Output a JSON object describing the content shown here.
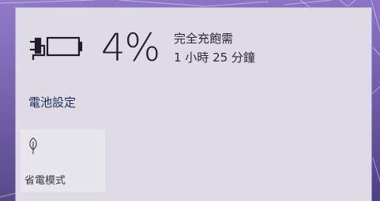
{
  "battery": {
    "percent": "4%",
    "status": "完全充飽需",
    "time_remaining": "1 小時 25 分鐘"
  },
  "settings_link": "電池設定",
  "quick_action": {
    "label": "省電模式",
    "icon": "leaf-icon"
  }
}
